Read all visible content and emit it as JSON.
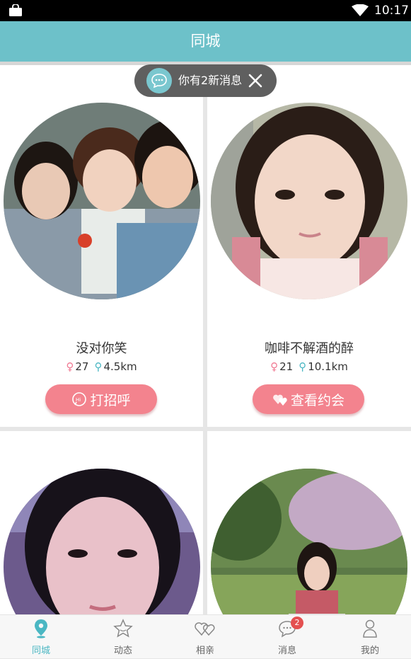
{
  "status_bar": {
    "time": "10:17"
  },
  "header": {
    "title": "同城"
  },
  "toast": {
    "text": "你有2新消息"
  },
  "profiles": [
    {
      "name": "没对你笑",
      "age": "27",
      "distance": "4.5km",
      "action": "打招呼"
    },
    {
      "name": "咖啡不解酒的醉",
      "age": "21",
      "distance": "10.1km",
      "action": "查看约会"
    }
  ],
  "tabs": [
    {
      "label": "同城"
    },
    {
      "label": "动态"
    },
    {
      "label": "相亲"
    },
    {
      "label": "消息",
      "badge": "2"
    },
    {
      "label": "我的"
    }
  ],
  "colors": {
    "accent": "#6dc1c9",
    "button": "#f3838e",
    "badge": "#e45050"
  }
}
